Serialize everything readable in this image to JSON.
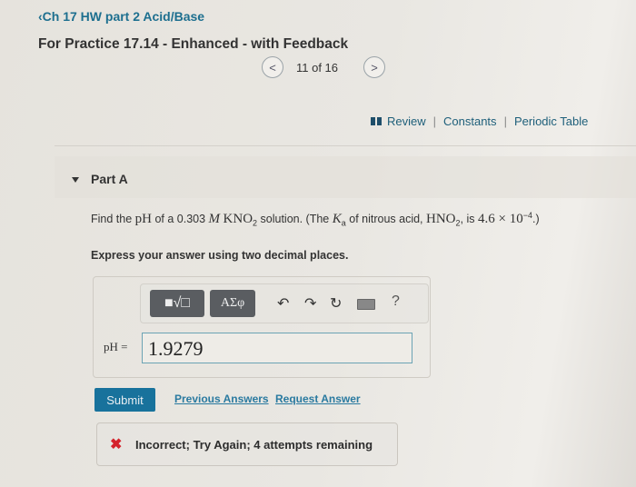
{
  "header": {
    "back_link": "‹Ch 17 HW part 2 Acid/Base",
    "title": "For Practice 17.14 - Enhanced - with Feedback",
    "pager": {
      "prev": "<",
      "text": "11 of 16",
      "next": ">"
    }
  },
  "resources": {
    "review": "Review",
    "separator": "|",
    "constants": "Constants",
    "periodic_table": "Periodic Table"
  },
  "part": {
    "label": "Part A",
    "question": {
      "t1": "Find the ",
      "ph": "pH",
      "t2": " of a 0.303 ",
      "M": "M",
      "kno": "KNO",
      "sub2": "2",
      "t3": " solution. (The ",
      "K": "K",
      "a": "a",
      "t4": " of nitrous acid, ",
      "hno": "HNO",
      "t5": ", is ",
      "val": "4.6 × 10",
      "exp": "−4",
      "t6": ".)"
    },
    "instructions": "Express your answer using two decimal places."
  },
  "toolbar": {
    "templates_label": "■√□",
    "greek_label": "ΑΣφ",
    "undo": "↶",
    "redo": "↷",
    "reset": "↻",
    "help": "?"
  },
  "answer": {
    "label": "pH =",
    "value": "1.9279"
  },
  "actions": {
    "submit": "Submit",
    "previous_answers": "Previous Answers",
    "request_answer": "Request Answer"
  },
  "feedback": {
    "icon": "✖",
    "text": "Incorrect; Try Again; 4 attempts remaining"
  }
}
